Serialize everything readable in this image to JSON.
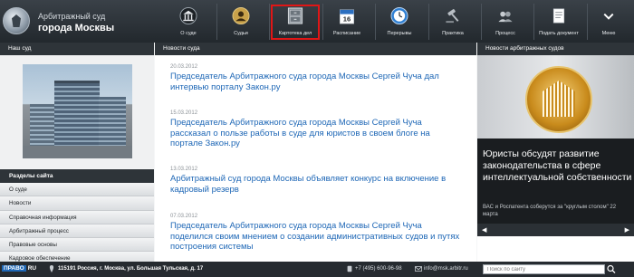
{
  "brand": {
    "line1": "Арбитражный суд",
    "line2": "города Москвы"
  },
  "nav": [
    {
      "label": "О суде",
      "icon": "building-icon"
    },
    {
      "label": "Судьи",
      "icon": "judges-icon"
    },
    {
      "label": "Картотека дел",
      "icon": "cabinet-icon",
      "highlighted": true
    },
    {
      "label": "Расписание",
      "icon": "calendar-icon",
      "icon_text": "16"
    },
    {
      "label": "Перерывы",
      "icon": "clock-icon"
    },
    {
      "label": "Практика",
      "icon": "gavel-icon"
    },
    {
      "label": "Процесс",
      "icon": "process-icon"
    },
    {
      "label": "Подать документ",
      "icon": "submit-document-icon"
    },
    {
      "label": "Меню",
      "icon": "chevron-down-icon"
    }
  ],
  "highlight_color": "#e01616",
  "left": {
    "header": "Наш суд",
    "sections_header": "Разделы сайта",
    "menu": [
      "О суде",
      "Новости",
      "Справочная информация",
      "Арбитражный процесс",
      "Правовые основы",
      "Кадровое обеспечение"
    ]
  },
  "center": {
    "header": "Новости суда",
    "news": [
      {
        "date": "20.03.2012",
        "title": "Председатель Арбитражного суда города Москвы Сергей Чуча дал интервью порталу Закон.ру"
      },
      {
        "date": "15.03.2012",
        "title": "Председатель Арбитражного суда города Москвы Сергей Чуча рассказал о пользе работы в суде для юристов в своем блоге на портале Закон.ру"
      },
      {
        "date": "13.03.2012",
        "title": "Арбитражный суд города Москвы объявляет конкурс на включение в кадровый резерв"
      },
      {
        "date": "07.03.2012",
        "title": "Председатель Арбитражного суда города Москвы Сергей Чуча поделился своим мнением о создании административных судов и путях построения системы"
      }
    ]
  },
  "right": {
    "header": "Новости арбитражных судов",
    "slide_title": "Юристы обсудят развитие законодательства в сфере интеллектуальной собственности",
    "slide_subtitle": "ВАС и Роспатента соберутся за \"круглым столом\" 22 марта",
    "dots_count": 5,
    "active_dot": 0
  },
  "footer": {
    "brand": "ПРАВО",
    "brand_suffix": "RU",
    "address": "115191 Россия, г. Москва, ул. Большая Тульская, д. 17",
    "phone": "+7 (495) 600-96-98",
    "email": "info@msk.arbitr.ru",
    "search_placeholder": "Поиск по сайту"
  }
}
